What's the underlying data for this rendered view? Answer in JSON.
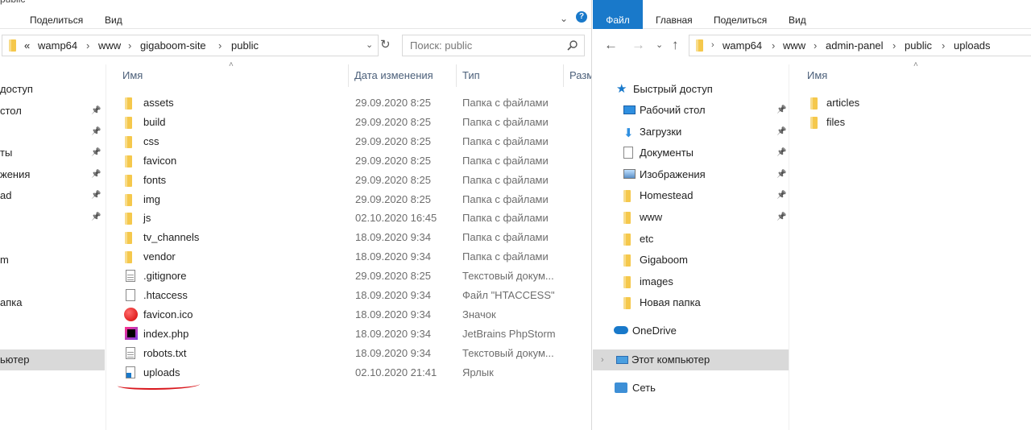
{
  "left_window": {
    "title_fragment": "public",
    "ribbon_tabs": [
      "Поделиться",
      "Вид"
    ],
    "breadcrumb": [
      "«",
      "wamp64",
      "www",
      "gigaboom-site",
      "public"
    ],
    "search_placeholder": "Поиск: public",
    "columns": {
      "name": "Имя",
      "date": "Дата изменения",
      "type": "Тип",
      "size": "Разм"
    },
    "nav_items": [
      {
        "label": "доступ",
        "pinned": false
      },
      {
        "label": "стол",
        "pinned": true
      },
      {
        "label": "",
        "pinned": true
      },
      {
        "label": "ты",
        "pinned": true
      },
      {
        "label": "жения",
        "pinned": true
      },
      {
        "label": "ad",
        "pinned": true
      },
      {
        "label": "",
        "pinned": true
      },
      {
        "label": "",
        "pinned": false
      },
      {
        "label": "m",
        "pinned": false
      },
      {
        "label": "",
        "pinned": false
      },
      {
        "label": "апка",
        "pinned": false
      },
      {
        "label": "",
        "pinned": false
      },
      {
        "label": "ьютер",
        "pinned": false,
        "selected": true
      }
    ],
    "files": [
      {
        "name": "assets",
        "date": "29.09.2020 8:25",
        "type": "Папка с файлами",
        "icon": "folder-icon"
      },
      {
        "name": "build",
        "date": "29.09.2020 8:25",
        "type": "Папка с файлами",
        "icon": "folder-icon"
      },
      {
        "name": "css",
        "date": "29.09.2020 8:25",
        "type": "Папка с файлами",
        "icon": "folder-icon"
      },
      {
        "name": "favicon",
        "date": "29.09.2020 8:25",
        "type": "Папка с файлами",
        "icon": "folder-icon"
      },
      {
        "name": "fonts",
        "date": "29.09.2020 8:25",
        "type": "Папка с файлами",
        "icon": "folder-icon"
      },
      {
        "name": "img",
        "date": "29.09.2020 8:25",
        "type": "Папка с файлами",
        "icon": "folder-icon"
      },
      {
        "name": "js",
        "date": "02.10.2020 16:45",
        "type": "Папка с файлами",
        "icon": "folder-icon"
      },
      {
        "name": "tv_channels",
        "date": "18.09.2020 9:34",
        "type": "Папка с файлами",
        "icon": "folder-icon"
      },
      {
        "name": "vendor",
        "date": "18.09.2020 9:34",
        "type": "Папка с файлами",
        "icon": "folder-icon"
      },
      {
        "name": ".gitignore",
        "date": "29.09.2020 8:25",
        "type": "Текстовый докум...",
        "icon": "text-file-icon"
      },
      {
        "name": ".htaccess",
        "date": "18.09.2020 9:34",
        "type": "Файл \"HTACCESS\"",
        "icon": "blank-file-icon"
      },
      {
        "name": "favicon.ico",
        "date": "18.09.2020 9:34",
        "type": "Значок",
        "icon": "favicon-icon"
      },
      {
        "name": "index.php",
        "date": "18.09.2020 9:34",
        "type": "JetBrains PhpStorm",
        "icon": "phpstorm-icon"
      },
      {
        "name": "robots.txt",
        "date": "18.09.2020 9:34",
        "type": "Текстовый докум...",
        "icon": "text-file-icon"
      },
      {
        "name": "uploads",
        "date": "02.10.2020 21:41",
        "type": "Ярлык",
        "icon": "shortcut-icon"
      }
    ]
  },
  "right_window": {
    "ribbon_tabs": [
      "Файл",
      "Главная",
      "Поделиться",
      "Вид"
    ],
    "breadcrumb": [
      "wamp64",
      "www",
      "admin-panel",
      "public",
      "uploads"
    ],
    "column_name": "Имя",
    "quick_access": "Быстрый доступ",
    "nav_items": [
      {
        "label": "Рабочий стол",
        "pinned": true,
        "icon": "desktop-icon"
      },
      {
        "label": "Загрузки",
        "pinned": true,
        "icon": "download-icon"
      },
      {
        "label": "Документы",
        "pinned": true,
        "icon": "documents-icon"
      },
      {
        "label": "Изображения",
        "pinned": true,
        "icon": "pictures-icon"
      },
      {
        "label": "Homestead",
        "pinned": true,
        "icon": "folder-icon"
      },
      {
        "label": "www",
        "pinned": true,
        "icon": "folder-icon"
      },
      {
        "label": "etc",
        "pinned": false,
        "icon": "folder-icon"
      },
      {
        "label": "Gigaboom",
        "pinned": false,
        "icon": "folder-icon"
      },
      {
        "label": "images",
        "pinned": false,
        "icon": "folder-icon"
      },
      {
        "label": "Новая папка",
        "pinned": false,
        "icon": "folder-icon"
      }
    ],
    "onedrive": "OneDrive",
    "this_pc": "Этот компьютер",
    "network": "Сеть",
    "files": [
      {
        "name": "articles",
        "icon": "folder-icon"
      },
      {
        "name": "files",
        "icon": "folder-icon"
      }
    ]
  },
  "colors": {
    "accent": "#1979ca",
    "selection": "#d9d9d9",
    "folder": "#f8d775",
    "underline": "#d9171d"
  }
}
